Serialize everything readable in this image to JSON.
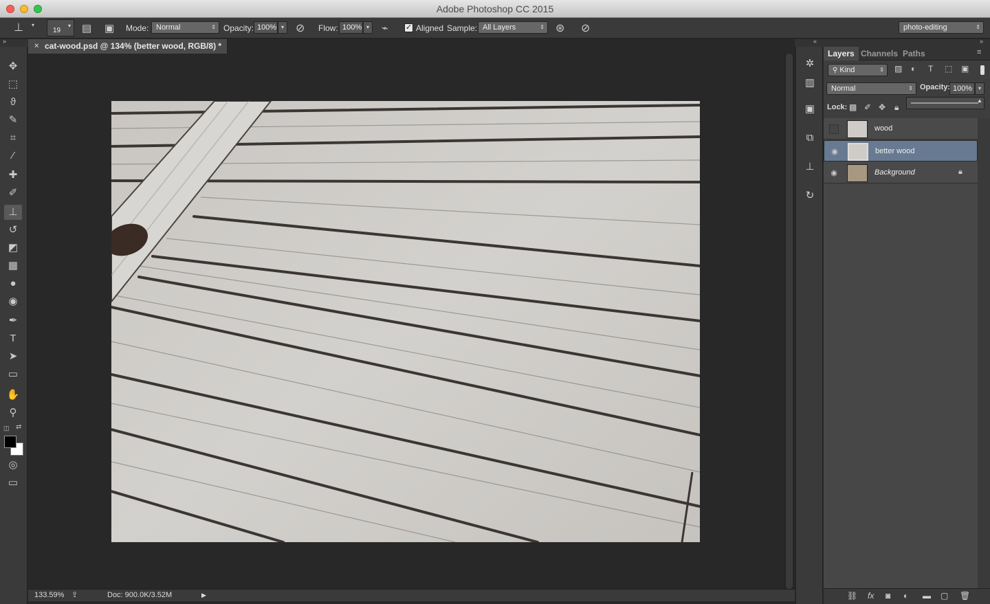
{
  "window": {
    "title": "Adobe Photoshop CC 2015"
  },
  "options": {
    "brush_size": "19",
    "mode_label": "Mode:",
    "mode_value": "Normal",
    "opacity_label": "Opacity:",
    "opacity_value": "100%",
    "flow_label": "Flow:",
    "flow_value": "100%",
    "aligned_label": "Aligned",
    "sample_label": "Sample:",
    "sample_value": "All Layers",
    "workspace": "photo-editing"
  },
  "document": {
    "tab_title": "cat-wood.psd @ 134% (better wood, RGB/8) *",
    "zoom": "133.59%",
    "doc_info": "Doc: 900.0K/3.52M"
  },
  "panels": {
    "tabs": [
      "Layers",
      "Channels",
      "Paths"
    ],
    "filter_kind": "Kind",
    "blend_mode": "Normal",
    "opacity_label": "Opacity:",
    "opacity_value": "100%",
    "lock_label": "Lock:",
    "layers": [
      {
        "name": "wood",
        "visible": false,
        "selected": false
      },
      {
        "name": "better wood",
        "visible": true,
        "selected": true
      },
      {
        "name": "Background",
        "visible": true,
        "selected": false,
        "locked": true
      }
    ]
  },
  "colors": {
    "selection": "#677a91",
    "panel": "#3e3e3e",
    "wood": "#cfccc8"
  }
}
